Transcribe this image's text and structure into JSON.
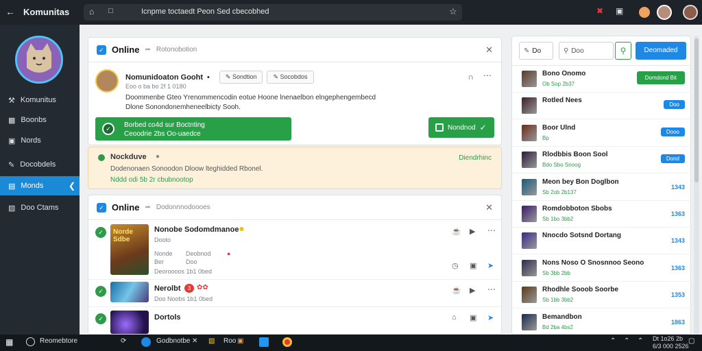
{
  "app": {
    "title": "Komunitas"
  },
  "browser": {
    "url": "Icnpme toctaedt Peon Sed cbecobhed",
    "star_icon": "star-icon"
  },
  "sidebar": {
    "items": [
      {
        "label": "Komunitus",
        "icon": "wrench-icon"
      },
      {
        "label": "Boonbs",
        "icon": "chart-icon"
      },
      {
        "label": "Nords",
        "icon": "photo-icon"
      },
      {
        "label": "Docobdels",
        "icon": "pen-icon"
      },
      {
        "label": "Monds",
        "icon": "monitor-icon"
      },
      {
        "label": "Doo Ctams",
        "icon": "folder-icon"
      }
    ]
  },
  "card1": {
    "title": "Online",
    "subtitle": "Rotonobotion",
    "post": {
      "author": "Nomunidoaton Gooht",
      "author_suffix": "•",
      "pill1": "Sondtion",
      "pill2": "Socobdos",
      "meta": "Eoo o ba bo 2f 1 0180",
      "body_line1": "Doommenbe Gteo Yrenommencodin eotue Hoone lnenaelbon elngephengembecd",
      "body_line2": "Dlone Sonondonemheneelbicty Sooh."
    },
    "bar_line1": "Borbed co4d sur Boctnting",
    "bar_line2": "Ceoodrie 2bs Oo-uaedce",
    "confirm_label": "Nondnod"
  },
  "notice": {
    "title": "Nockduve",
    "action": "Diendrhinc",
    "line1": "Dodenonaen Sonoodon Dloow lteghidded Rbonel.",
    "line2": "Nddd odi 5b 2r cbubnootop"
  },
  "card2": {
    "title": "Online",
    "subtitle": "Dodonnnodoooes",
    "items": [
      {
        "title": "Nonobe Sodomdmanoe",
        "sub": "Dooto",
        "meta1": "Nonde",
        "meta2": "Deobnod",
        "meta3": "Ber",
        "meta4": "Doo",
        "meta5": "Deoroooos 1b1 0bed",
        "thumb_text": "Norde Sdbe"
      },
      {
        "title": "Nerolbt",
        "sub": "Doo Noobs 1b1 0bed",
        "badge": "3"
      },
      {
        "title": "Dortols",
        "sub": ""
      }
    ]
  },
  "right": {
    "search_label1": "Do",
    "search_placeholder": "Doo",
    "search_button": "Deomaded",
    "rows": [
      {
        "name": "Bono Onomo",
        "meta": "Ob Sop 2b37",
        "action": "Domdond Bit",
        "kind": "green-button"
      },
      {
        "name": "Rotled Nees",
        "meta": "",
        "action": "Doo",
        "kind": "button"
      },
      {
        "name": "Boor Ulnd",
        "meta": "Bp",
        "action": "Dooo",
        "kind": "button"
      },
      {
        "name": "Rlodbbis Boon Sool",
        "meta": "Bdo Sbo Snoog",
        "action": "Dond",
        "kind": "button"
      },
      {
        "name": "Meon bey Bon Doglbon",
        "meta": "Sb 2ob 2b137",
        "action": "1343",
        "kind": "value"
      },
      {
        "name": "Romdobboton Sbobs",
        "meta": "Sb 1bo 3bb2",
        "action": "1363",
        "kind": "value"
      },
      {
        "name": "Nnocdo Sotsnd Dortang",
        "meta": "",
        "action": "1343",
        "kind": "value"
      },
      {
        "name": "Nons Noso O Snosnnoo Seono",
        "meta": "Sb 3bb 2bb",
        "action": "1363",
        "kind": "value"
      },
      {
        "name": "Rhodhle Sooob Soorbe",
        "meta": "Sb 1bb 3bb2",
        "action": "1353",
        "kind": "value"
      },
      {
        "name": "Bemandbon",
        "meta": "Bd 2ba 4bs2",
        "action": "1863",
        "kind": "value"
      }
    ]
  },
  "taskbar": {
    "search": "Reomebtore",
    "tab": "Godbnotbe",
    "tab2": "Roo",
    "time": "Dt 1o26 2b",
    "date": "6/3 000 2526"
  },
  "colors": {
    "accent": "#1e88e5",
    "green": "#27a048",
    "sidebar": "#232a31",
    "notice_bg": "#fdf1dc"
  }
}
